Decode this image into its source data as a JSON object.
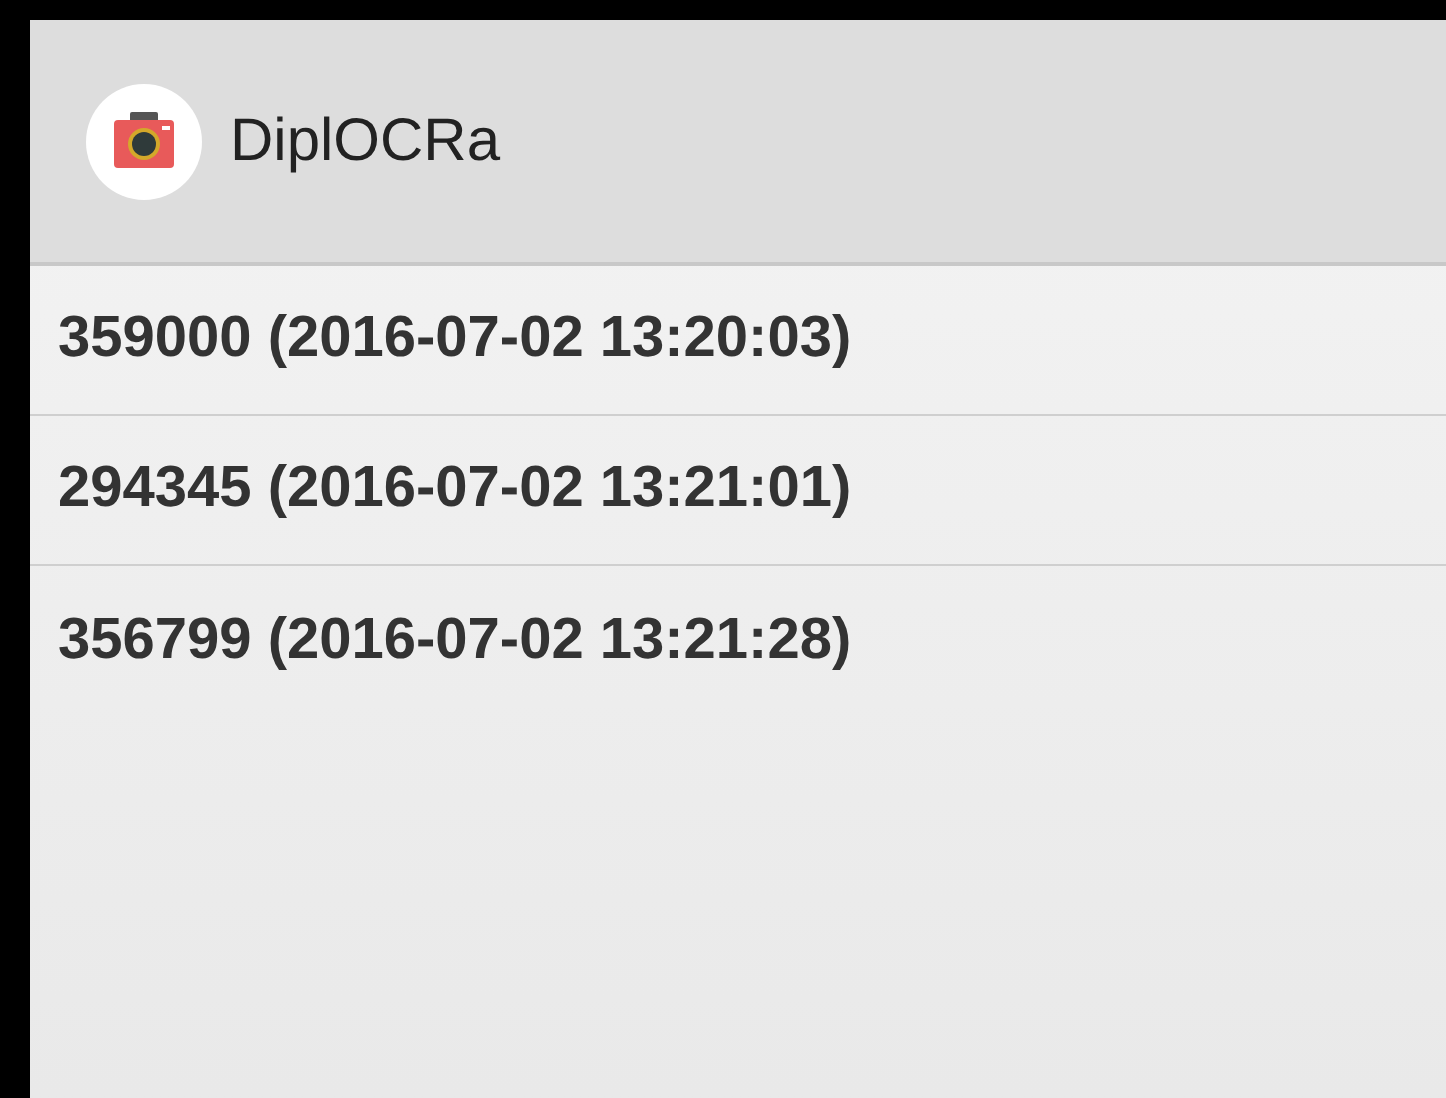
{
  "app_bar": {
    "title": "DiplOCRa"
  },
  "list": [
    {
      "text": "359000 (2016-07-02 13:20:03)"
    },
    {
      "text": "294345 (2016-07-02 13:21:01)"
    },
    {
      "text": "356799 (2016-07-02 13:21:28)"
    }
  ]
}
